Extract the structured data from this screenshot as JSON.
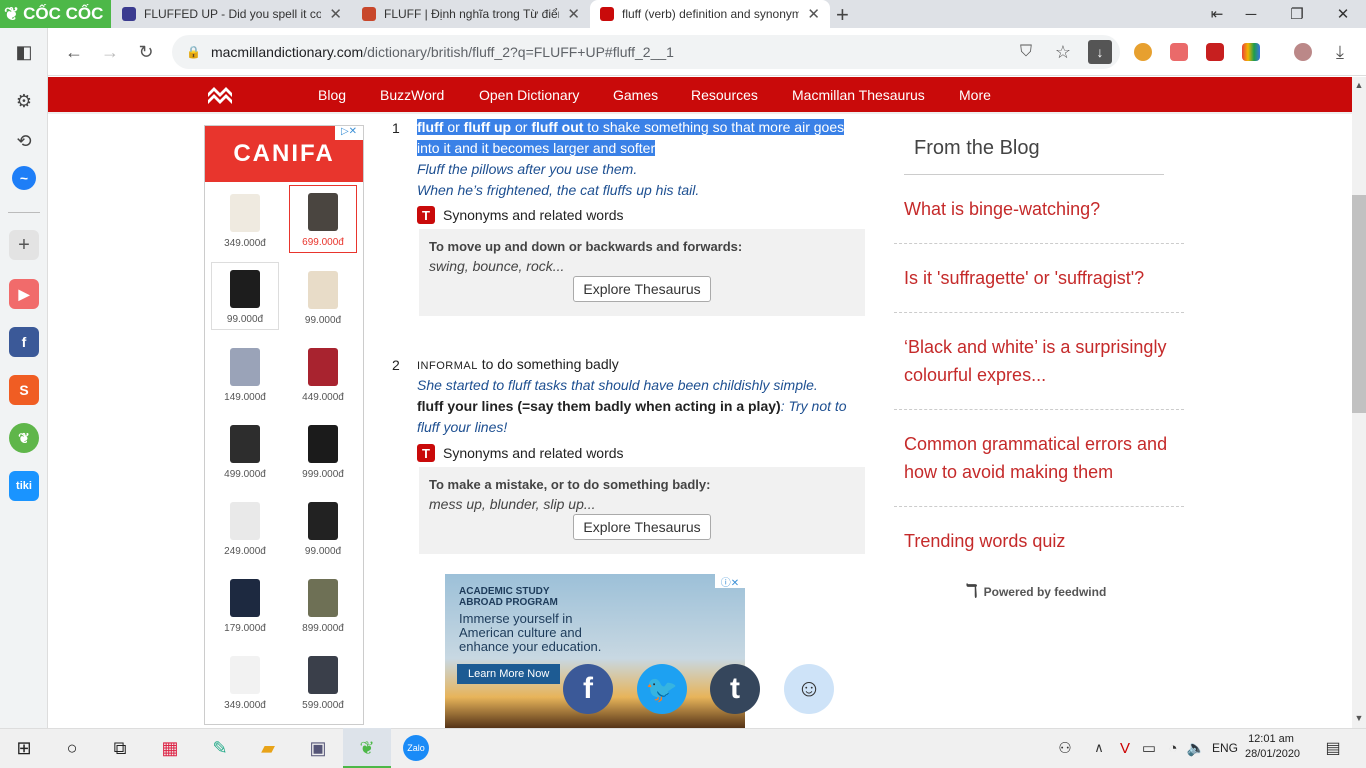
{
  "browser": {
    "brand": "CỐC CỐC",
    "tabs": [
      {
        "title": "FLUFFED UP - Did you spell it corr",
        "active": false,
        "favicon_color": "#3b3b8f"
      },
      {
        "title": "FLUFF | Định nghĩa trong Từ điển t",
        "active": false,
        "favicon_color": "#c8472b"
      },
      {
        "title": "fluff (verb) definition and synonym",
        "active": true,
        "favicon_color": "#c90a0a"
      }
    ],
    "new_tab": "+",
    "url_host": "macmillandictionary.com",
    "url_path": "/dictionary/british/fluff_2?q=FLUFF+UP#fluff_2__1"
  },
  "nav": {
    "items": [
      "Blog",
      "BuzzWord",
      "Open Dictionary",
      "Games",
      "Resources",
      "Macmillan Thesaurus",
      "More"
    ]
  },
  "ad_left": {
    "brand": "CANIFA",
    "products": [
      {
        "price": "349.000đ",
        "color": "#efeae0"
      },
      {
        "price": "699.000đ",
        "color": "#4a4540"
      },
      {
        "price": "99.000đ",
        "color": "#1d1d1d"
      },
      {
        "price": "99.000đ",
        "color": "#e8dcc8"
      },
      {
        "price": "149.000đ",
        "color": "#9aa3b8"
      },
      {
        "price": "449.000đ",
        "color": "#a8232f"
      },
      {
        "price": "499.000đ",
        "color": "#2d2d2d"
      },
      {
        "price": "999.000đ",
        "color": "#1b1b1b"
      },
      {
        "price": "249.000đ",
        "color": "#e9e9e9"
      },
      {
        "price": "99.000đ",
        "color": "#222222"
      },
      {
        "price": "179.000đ",
        "color": "#1d2940"
      },
      {
        "price": "899.000đ",
        "color": "#6e7055"
      },
      {
        "price": "349.000đ",
        "color": "#f2f2f2"
      },
      {
        "price": "599.000đ",
        "color": "#3a3f4a"
      }
    ]
  },
  "senses": [
    {
      "number": "1",
      "def_parts": [
        "fluff",
        " or ",
        "fluff up",
        " or ",
        "fluff out",
        " to shake something so that more air goes",
        "into it and it becomes larger and softer"
      ],
      "examples": [
        "Fluff the pillows after you use them.",
        "When he’s frightened, the cat fluffs up his tail."
      ],
      "synonyms_label": "Synonyms and related words",
      "thesaurus_heading": "To move up and down or backwards and forwards:",
      "thesaurus_words": "swing, bounce, rock...",
      "thesaurus_button": "Explore Thesaurus"
    },
    {
      "number": "2",
      "register": "INFORMAL",
      "definition": " to do something badly",
      "examples": [
        "She started to fluff tasks that should have been childishly simple."
      ],
      "phrase": "fluff your lines (=say them badly when acting in a play)",
      "phrase_example": ": Try not to",
      "phrase_example2": "fluff your lines!",
      "synonyms_label": "Synonyms and related words",
      "thesaurus_heading": "To make a mistake, or to do something badly:",
      "thesaurus_words": "mess up, blunder, slip up...",
      "thesaurus_button": "Explore Thesaurus"
    }
  ],
  "ad_bottom": {
    "line1": "ACADEMIC STUDY",
    "line2": "ABROAD PROGRAM",
    "body": "Immerse yourself in American culture and enhance your education.",
    "cta": "Learn More Now"
  },
  "share": [
    {
      "name": "facebook",
      "glyph": "f",
      "color": "#3b5998"
    },
    {
      "name": "twitter",
      "glyph": "t",
      "color": "#1da1f2"
    },
    {
      "name": "tumblr",
      "glyph": "t",
      "color": "#35465c"
    },
    {
      "name": "reddit",
      "glyph": "",
      "color": "#cee3f8"
    }
  ],
  "blog": {
    "title": "From the Blog",
    "items": [
      "What is binge-watching?",
      "Is it 'suffragette' or 'suffragist'?",
      "‘Black and white’ is a surprisingly colourful expres...",
      "Common grammatical errors and how to avoid making them",
      "Trending words quiz"
    ],
    "powered": "Powered by feedwind"
  },
  "taskbar": {
    "lang": "ENG",
    "time": "12:01 am",
    "date": "28/01/2020"
  }
}
